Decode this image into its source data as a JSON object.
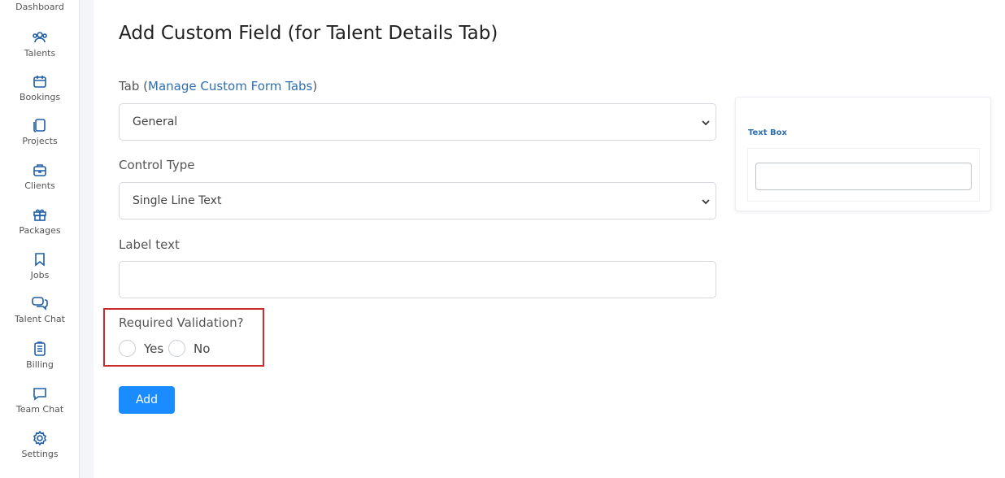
{
  "sidebar": {
    "items": [
      {
        "label": "Dashboard",
        "icon": "dashboard-icon"
      },
      {
        "label": "Talents",
        "icon": "users-icon"
      },
      {
        "label": "Bookings",
        "icon": "calendar-icon"
      },
      {
        "label": "Projects",
        "icon": "copy-icon"
      },
      {
        "label": "Clients",
        "icon": "briefcase-icon"
      },
      {
        "label": "Packages",
        "icon": "gift-icon"
      },
      {
        "label": "Jobs",
        "icon": "bookmark-icon"
      },
      {
        "label": "Talent Chat",
        "icon": "chat-bubbles-icon"
      },
      {
        "label": "Billing",
        "icon": "clipboard-icon"
      },
      {
        "label": "Team Chat",
        "icon": "message-square-icon"
      },
      {
        "label": "Settings",
        "icon": "gear-icon"
      }
    ]
  },
  "main": {
    "title": "Add Custom Field (for Talent Details Tab)",
    "tab_label": "Tab (",
    "tab_link": "Manage Custom Form Tabs",
    "tab_label_end": ")",
    "tab_value": "General",
    "control_type_label": "Control Type",
    "control_type_value": "Single Line Text",
    "label_text_label": "Label text",
    "label_text_value": "",
    "required_label": "Required Validation?",
    "yes_label": "Yes",
    "no_label": "No",
    "add_button": "Add"
  },
  "preview": {
    "title": "Text Box",
    "input_value": ""
  },
  "colors": {
    "accent": "#1a8cff",
    "link": "#2f6fb0",
    "highlight_border": "#cc2b2b",
    "sidebar_icon": "#1f5fa8"
  }
}
